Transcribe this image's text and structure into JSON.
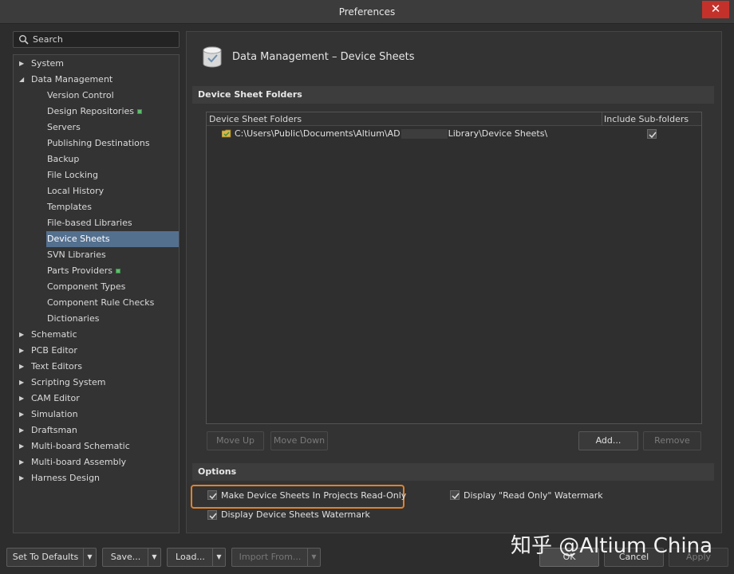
{
  "window": {
    "title": "Preferences",
    "close_glyph": "✕"
  },
  "search": {
    "placeholder": "Search"
  },
  "tree": {
    "top": [
      {
        "label": "System",
        "expanded": false
      },
      {
        "label": "Data Management",
        "expanded": true
      }
    ],
    "data_management_children": [
      "Version Control",
      "Design Repositories",
      "Servers",
      "Publishing Destinations",
      "Backup",
      "File Locking",
      "Local History",
      "Templates",
      "File-based Libraries",
      "Device Sheets",
      "SVN Libraries",
      "Parts Providers",
      "Component Types",
      "Component Rule Checks",
      "Dictionaries"
    ],
    "selected": "Device Sheets",
    "bottom": [
      "Schematic",
      "PCB Editor",
      "Text Editors",
      "Scripting System",
      "CAM Editor",
      "Simulation",
      "Draftsman",
      "Multi-board Schematic",
      "Multi-board Assembly",
      "Harness Design"
    ]
  },
  "page": {
    "title": "Data Management – Device Sheets"
  },
  "folders_section": {
    "heading": "Device Sheet Folders",
    "columns": [
      "Device Sheet Folders",
      "Include Sub-folders"
    ],
    "rows": [
      {
        "path_start": "C:\\Users\\Public\\Documents\\Altium\\AD",
        "path_end": "Library\\Device Sheets\\",
        "include_subfolders": true
      }
    ],
    "buttons": {
      "move_up": "Move Up",
      "move_down": "Move Down",
      "add": "Add...",
      "remove": "Remove"
    }
  },
  "options": {
    "heading": "Options",
    "read_only": {
      "label": "Make Device Sheets In Projects Read-Only",
      "checked": true
    },
    "read_only_watermark": {
      "label": "Display \"Read Only\" Watermark",
      "checked": true
    },
    "sheets_watermark": {
      "label": "Display Device Sheets Watermark",
      "checked": true
    }
  },
  "footer": {
    "set_to_defaults": "Set To Defaults",
    "save": "Save...",
    "load": "Load...",
    "import_from": "Import From...",
    "ok": "OK",
    "cancel": "Cancel",
    "apply": "Apply"
  },
  "watermark": "知乎 @Altium China",
  "colors": {
    "accent_selected": "#54708f",
    "highlight_border": "#e0822d",
    "close_red": "#c4312b"
  }
}
